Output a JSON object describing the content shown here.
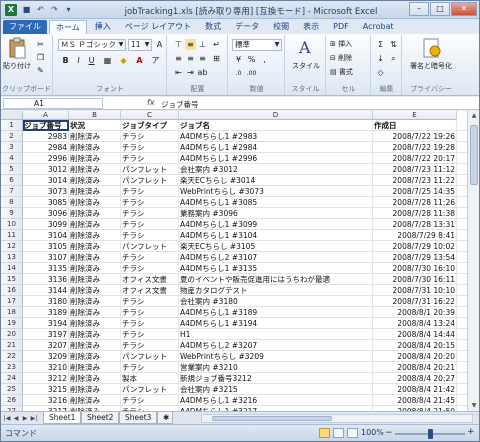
{
  "window": {
    "title": "jobTracking1.xls [読み取り専用] [互換モード] - Microsoft Excel",
    "app_icon": "excel-logo-icon",
    "controls": [
      "minimize-icon",
      "maximize-icon",
      "close-icon"
    ]
  },
  "quick_access": [
    "save-icon",
    "undo-icon",
    "redo-icon",
    "customize-icon"
  ],
  "tabs": [
    {
      "label": "ファイル"
    },
    {
      "label": "ホーム"
    },
    {
      "label": "挿入"
    },
    {
      "label": "ページ レイアウト"
    },
    {
      "label": "数式"
    },
    {
      "label": "データ"
    },
    {
      "label": "校閲"
    },
    {
      "label": "表示"
    },
    {
      "label": "PDF"
    },
    {
      "label": "Acrobat"
    }
  ],
  "ribbon": {
    "clipboard": {
      "label": "クリップボード",
      "paste": "貼り付け"
    },
    "font": {
      "label": "フォント",
      "name": "ＭＳ Ｐゴシック",
      "size": "11"
    },
    "alignment": {
      "label": "配置"
    },
    "number": {
      "label": "数値",
      "format": "標準"
    },
    "styles": {
      "label": "スタイル",
      "button": "スタイル"
    },
    "cells": {
      "label": "セル",
      "insert": "挿入",
      "delete": "削除",
      "format": "書式"
    },
    "editing": {
      "label": "編集"
    },
    "privacy": {
      "label": "プライバシー",
      "button": "署名と暗号化"
    }
  },
  "formula_bar": {
    "cell_ref": "A1",
    "fx": "fx",
    "value": "ジョブ番号"
  },
  "columns": [
    "A",
    "B",
    "C",
    "D",
    "E"
  ],
  "rows": [
    [
      "ジョブ番号",
      "状況",
      "ジョブタイプ",
      "ジョブ名",
      "作成日"
    ],
    [
      "2983",
      "削除済み",
      "チラシ",
      "A4DMちらし1 #2983",
      "2008/7/22 19:26"
    ],
    [
      "2984",
      "削除済み",
      "チラシ",
      "A4DMちらし1 #2984",
      "2008/7/22 19:28"
    ],
    [
      "2996",
      "削除済み",
      "チラシ",
      "A4DMちらし1 #2996",
      "2008/7/22 20:17"
    ],
    [
      "3012",
      "削除済み",
      "パンフレット",
      "会社案内 #3012",
      "2008/7/23 11:12"
    ],
    [
      "3014",
      "削除済み",
      "パンフレット",
      "楽天ECちらし #3014",
      "2008/7/23 11:22"
    ],
    [
      "3073",
      "削除済み",
      "チラシ",
      "WebPrintちらし #3073",
      "2008/7/25 14:35"
    ],
    [
      "3085",
      "削除済み",
      "チラシ",
      "A4DMちらし1 #3085",
      "2008/7/28 11:26"
    ],
    [
      "3096",
      "削除済み",
      "チラシ",
      "業務案内 #3096",
      "2008/7/28 11:38"
    ],
    [
      "3099",
      "削除済み",
      "チラシ",
      "A4DMちらし1 #3099",
      "2008/7/28 13:31"
    ],
    [
      "3104",
      "削除済み",
      "チラシ",
      "A4DMちらし1 #3104",
      "2008/7/29 8:41"
    ],
    [
      "3105",
      "削除済み",
      "パンフレット",
      "楽天ECちらし #3105",
      "2008/7/29 10:02"
    ],
    [
      "3107",
      "削除済み",
      "チラシ",
      "A4DMちらし2 #3107",
      "2008/7/29 13:54"
    ],
    [
      "3135",
      "削除済み",
      "チラシ",
      "A4DMちらし1 #3135",
      "2008/7/30 16:10"
    ],
    [
      "3136",
      "削除済み",
      "オフィス文書",
      "夏のイベントや販売促進用にはうちわが最適",
      "2008/7/30 16:11"
    ],
    [
      "3144",
      "削除済み",
      "オフィス文書",
      "物産カタログテスト",
      "2008/7/31 10:10"
    ],
    [
      "3180",
      "削除済み",
      "チラシ",
      "会社案内 #3180",
      "2008/7/31 16:22"
    ],
    [
      "3189",
      "削除済み",
      "チラシ",
      "A4DMちらし1 #3189",
      "2008/8/1 20:39"
    ],
    [
      "3194",
      "削除済み",
      "チラシ",
      "A4DMちらし1 #3194",
      "2008/8/4 13:24"
    ],
    [
      "3197",
      "削除済み",
      "チラシ",
      "H1",
      "2008/8/4 14:44"
    ],
    [
      "3207",
      "削除済み",
      "チラシ",
      "A4DMちらし2 #3207",
      "2008/8/4 20:15"
    ],
    [
      "3209",
      "削除済み",
      "パンフレット",
      "WebPrintちらし #3209",
      "2008/8/4 20:20"
    ],
    [
      "3210",
      "削除済み",
      "チラシ",
      "営業案内 #3210",
      "2008/8/4 20:21"
    ],
    [
      "3212",
      "削除済み",
      "製本",
      "新規ジョブ番号3212",
      "2008/8/4 20:27"
    ],
    [
      "3215",
      "削除済み",
      "パンフレット",
      "会社案内 #3215",
      "2008/8/4 21:42"
    ],
    [
      "3216",
      "削除済み",
      "チラシ",
      "A4DMちらし1 #3216",
      "2008/8/4 21:45"
    ],
    [
      "3217",
      "削除済み",
      "チラシ",
      "A4DMちらし1 #3217",
      "2008/8/4 21:50"
    ]
  ],
  "sheets": [
    "Sheet1",
    "Sheet2",
    "Sheet3"
  ],
  "status": {
    "text": "コマンド",
    "zoom": "100%",
    "zoom_level_percent": 100
  }
}
